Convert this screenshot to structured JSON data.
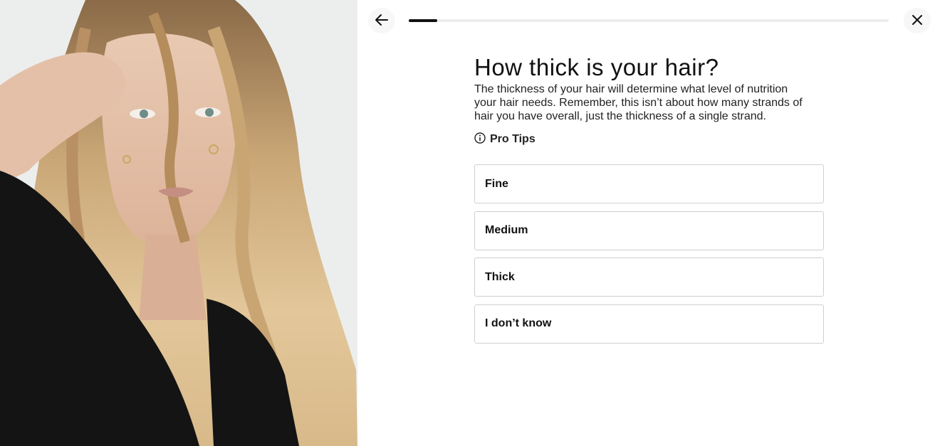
{
  "photo": {
    "subject": "portrait-photo"
  },
  "nav": {
    "back_icon": "arrow-left-icon",
    "close_icon": "close-icon",
    "progress": 0.06
  },
  "question": {
    "title": "How thick is your hair?",
    "description": "The thickness of your hair will determine what level of nutrition your hair needs. Remember, this isn’t about how many strands of hair you have overall, just the thickness of a single strand."
  },
  "pro_tips": {
    "label": "Pro Tips",
    "icon": "info-icon"
  },
  "options": [
    {
      "label": "Fine"
    },
    {
      "label": "Medium"
    },
    {
      "label": "Thick"
    },
    {
      "label": "I don’t know"
    }
  ],
  "colors": {
    "text": "#111111",
    "border": "#cfcfcf",
    "progress_fill": "#111111",
    "progress_track": "#ededed"
  }
}
